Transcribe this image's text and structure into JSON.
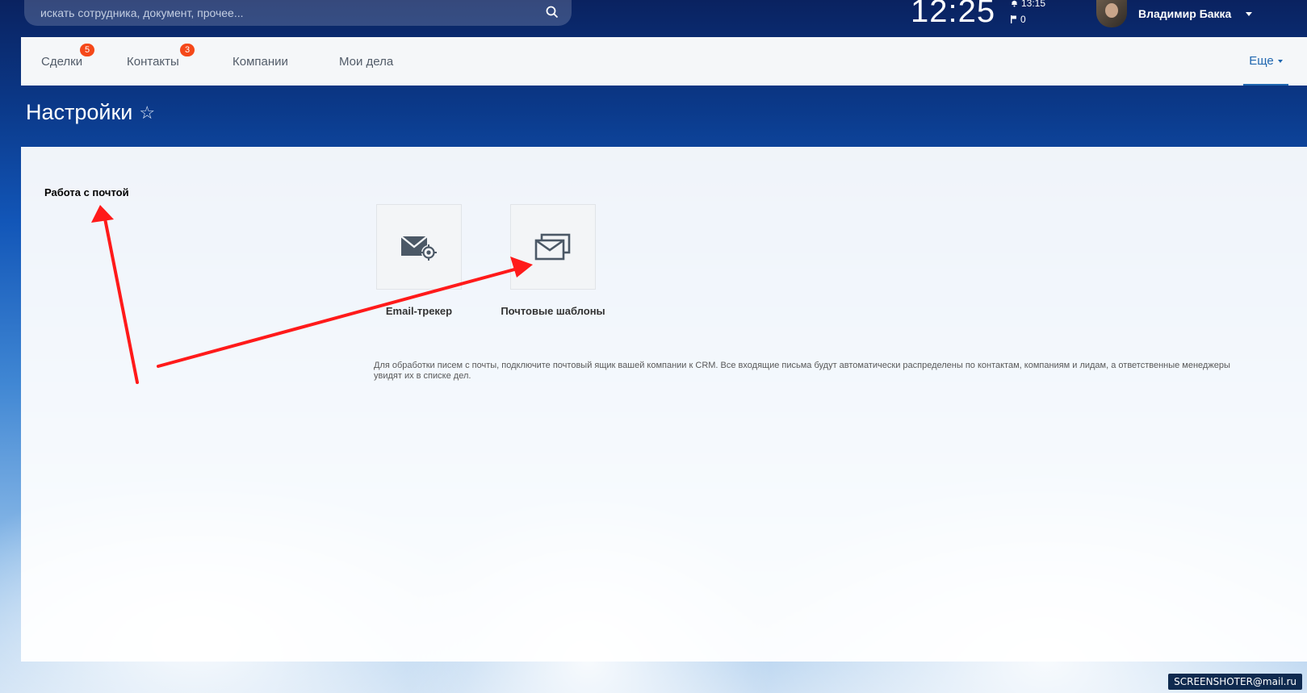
{
  "topbar": {
    "search_placeholder": "искать сотрудника, документ, прочее...",
    "clock": "12:25",
    "bell_time": "13:15",
    "flag_count": "0",
    "user_name": "Владимир Бакка"
  },
  "nav": {
    "items": [
      {
        "label": "Сделки",
        "badge": "5"
      },
      {
        "label": "Контакты",
        "badge": "3"
      },
      {
        "label": "Компании",
        "badge": ""
      },
      {
        "label": "Мои дела",
        "badge": ""
      }
    ],
    "more_label": "Еще"
  },
  "page": {
    "title": "Настройки",
    "star": "☆"
  },
  "content": {
    "section_title": "Работа с почтой",
    "tiles": [
      {
        "label": "Email-трекер",
        "icon": "email-tracker-icon"
      },
      {
        "label": "Почтовые шаблоны",
        "icon": "mail-templates-icon"
      }
    ],
    "description": "Для обработки писем с почты, подключите почтовый ящик вашей компании к CRM. Все входящие письма будут автоматически распределены по контактам, компаниям и лидам, а ответственные менеджеры увидят их в списке дел."
  },
  "watermark": {
    "text": "SCREENSHOTER@mail.ru"
  },
  "colors": {
    "accent": "#2067b0",
    "badge": "#f54819",
    "annotation_arrow": "#ff1a1a"
  }
}
